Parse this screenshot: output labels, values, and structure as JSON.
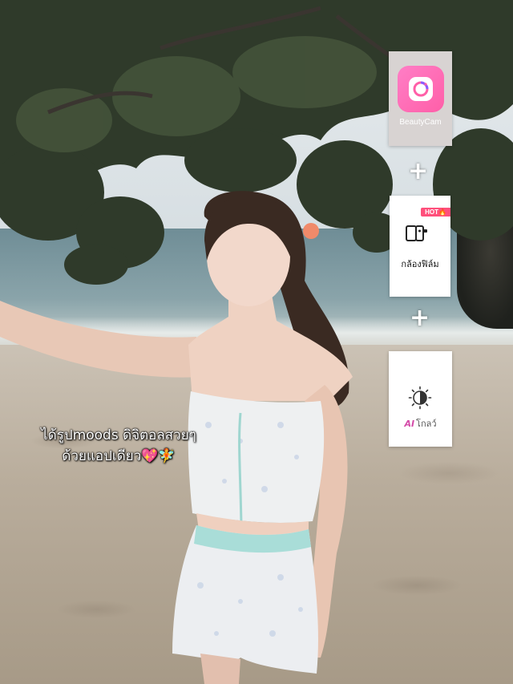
{
  "cards": {
    "app": {
      "label": "BeautyCam",
      "icon": "beautycam-logo-icon"
    },
    "plus_1": "+",
    "film": {
      "badge": "HOT🔥",
      "label": "กล้องฟิล์ม",
      "icon": "film-camera-icon"
    },
    "plus_2": "+",
    "glow": {
      "ai": "AI",
      "label": "โกลว์",
      "icon": "half-sun-glow-icon"
    }
  },
  "caption": {
    "line1": "ได้รูปmoods ดิจิตอลสวยๆ",
    "line2": "ด้วยแอปเดียว💖🧚"
  },
  "colors": {
    "accent_pink": "#ff5fa8",
    "hot_badge": "#ff4f7b",
    "ai_tag": "#d44aa8"
  }
}
